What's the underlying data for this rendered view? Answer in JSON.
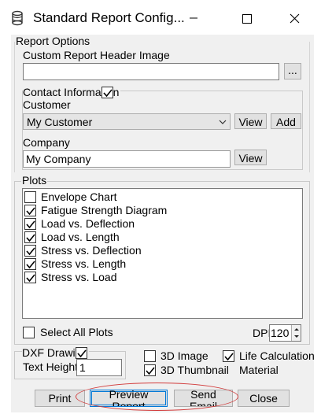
{
  "window": {
    "title": "Standard Report Config..."
  },
  "report_options": {
    "group_label": "Report Options",
    "header_image_label": "Custom Report Header Image",
    "header_image_value": "",
    "browse_label": "..."
  },
  "contact": {
    "group_label": "Contact Informa",
    "group_label_tail": "n",
    "checked": true,
    "customer_label": "Customer",
    "customer_value": "My Customer",
    "customer_view": "View",
    "customer_add": "Add",
    "company_label": "Company",
    "company_value": "My Company",
    "company_view": "View"
  },
  "plots": {
    "group_label": "Plots",
    "items": [
      {
        "label": "Envelope Chart",
        "checked": false
      },
      {
        "label": "Fatigue Strength Diagram",
        "checked": true
      },
      {
        "label": "Load vs. Deflection",
        "checked": true
      },
      {
        "label": "Load vs. Length",
        "checked": true
      },
      {
        "label": "Stress vs. Deflection",
        "checked": true
      },
      {
        "label": "Stress vs. Length",
        "checked": true
      },
      {
        "label": "Stress vs. Load",
        "checked": true
      }
    ],
    "select_all_label": "Select All Plots",
    "select_all_checked": false,
    "dpi_label": "DPI",
    "dpi_value": "120"
  },
  "dxf": {
    "group_label": "DXF Drawi",
    "checked": true,
    "text_height_label": "Text Height",
    "text_height_value": "1"
  },
  "options": {
    "image_3d_label": "3D Image",
    "image_3d_checked": false,
    "thumbnail_3d_label": "3D Thumbnail",
    "thumbnail_3d_checked": true,
    "life_calc_label": "Life Calculation",
    "life_calc_label2": "Material",
    "life_calc_checked": true
  },
  "buttons": {
    "print": "Print",
    "preview_line1": "Preview",
    "preview_line2": "Report",
    "send_line1": "Send",
    "send_line2": "Email",
    "close": "Close"
  },
  "colors": {
    "window_bg": "#f0f0f0",
    "button_bg": "#e1e1e1",
    "annotation_red": "#d23c3c",
    "focus_blue": "#0078d7"
  }
}
